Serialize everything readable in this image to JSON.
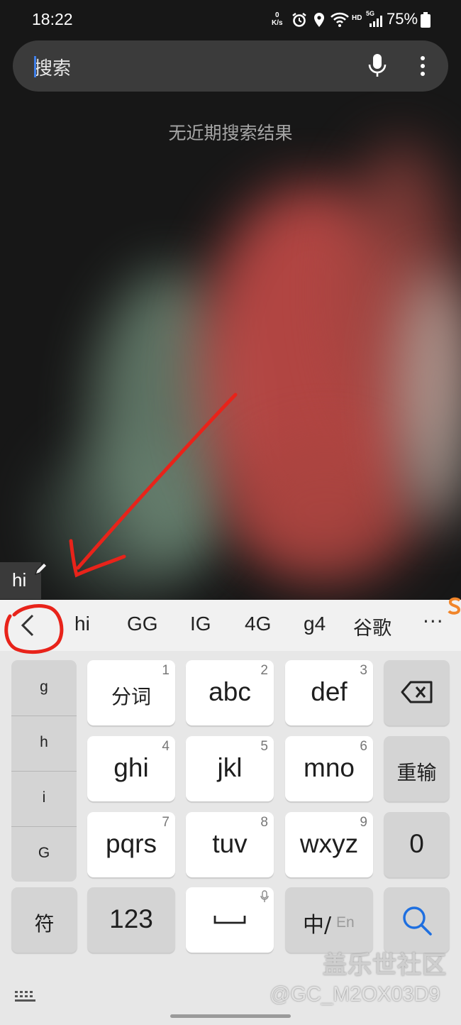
{
  "status_bar": {
    "time": "18:22",
    "net_speed_top": "0",
    "net_speed_bottom": "K/s",
    "hd": "HD",
    "network": "5G",
    "battery": "75%"
  },
  "search": {
    "placeholder": "搜索",
    "empty_message": "无近期搜索结果"
  },
  "composing_preview": "hi",
  "suggestions": {
    "items": [
      "hi",
      "GG",
      "IG",
      "4G",
      "g4",
      "谷歌"
    ],
    "more": "···"
  },
  "pinyin_candidates": [
    "g",
    "h",
    "i",
    "G"
  ],
  "keys": {
    "k1": {
      "label": "分词",
      "num": "1"
    },
    "k2": {
      "label": "abc",
      "num": "2"
    },
    "k3": {
      "label": "def",
      "num": "3"
    },
    "k4": {
      "label": "ghi",
      "num": "4"
    },
    "k5": {
      "label": "jkl",
      "num": "5"
    },
    "k6": {
      "label": "mno",
      "num": "6"
    },
    "k7": {
      "label": "pqrs",
      "num": "7"
    },
    "k8": {
      "label": "tuv",
      "num": "8"
    },
    "k9": {
      "label": "wxyz",
      "num": "9"
    },
    "retype": "重输",
    "zero": "0",
    "symbols": "符",
    "numbers": "123",
    "lang_cn": "中/",
    "lang_en": "En"
  },
  "watermark": {
    "line1": "盖乐世社区",
    "line2": "@GC_M2OX03D9"
  },
  "colors": {
    "accent": "#1e6fe0",
    "annotation": "#e8231a"
  }
}
